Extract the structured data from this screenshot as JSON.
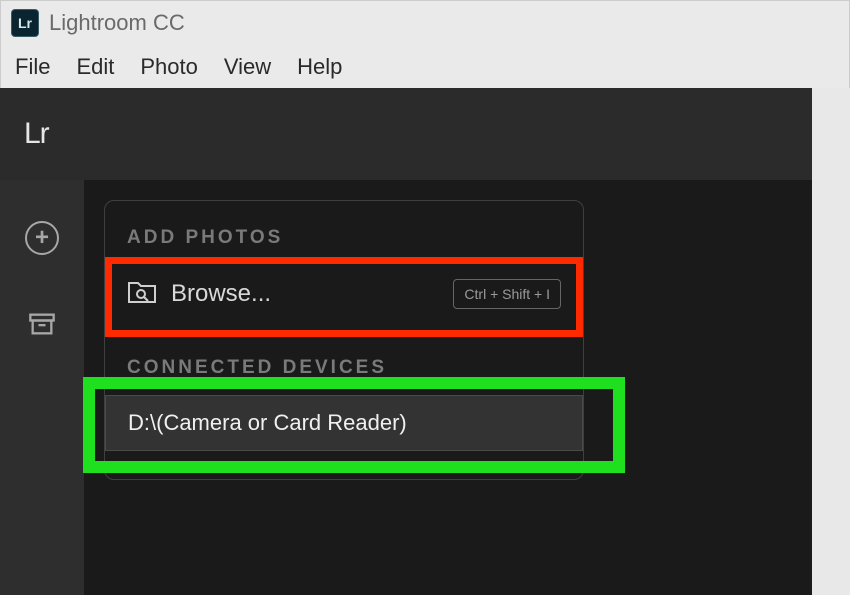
{
  "app": {
    "icon_text": "Lr",
    "title": "Lightroom CC"
  },
  "menubar": {
    "items": [
      "File",
      "Edit",
      "Photo",
      "View",
      "Help"
    ]
  },
  "logo": "Lr",
  "add_photos": {
    "heading": "ADD PHOTOS",
    "browse_label": "Browse...",
    "shortcut": "Ctrl + Shift + I"
  },
  "connected_devices": {
    "heading": "CONNECTED DEVICES",
    "items": [
      "D:\\(Camera or Card Reader)"
    ]
  }
}
